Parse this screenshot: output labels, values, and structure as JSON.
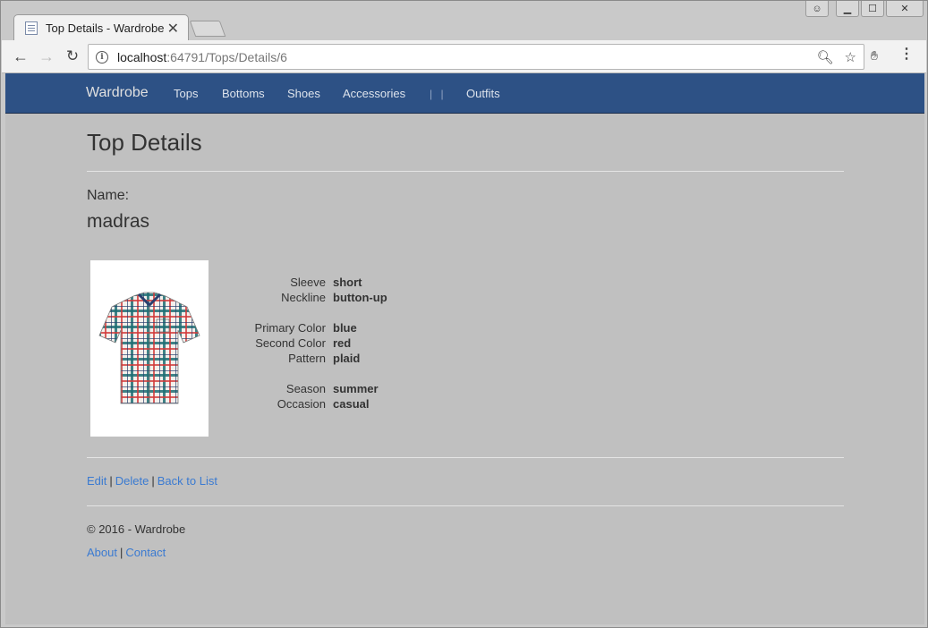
{
  "browser": {
    "tab_title": "Top Details - Wardrobe",
    "url_host": "localhost",
    "url_path": ":64791/Tops/Details/6"
  },
  "navbar": {
    "brand": "Wardrobe",
    "links": [
      "Tops",
      "Bottoms",
      "Shoes",
      "Accessories",
      "Outfits"
    ],
    "separator": "| |"
  },
  "page": {
    "title": "Top Details",
    "name_label": "Name:",
    "name_value": "madras",
    "image_alt": "plaid short-sleeve shirt",
    "attributes": [
      {
        "label": "Sleeve",
        "value": "short"
      },
      {
        "label": "Neckline",
        "value": "button-up"
      },
      {
        "label": "Primary Color",
        "value": "blue"
      },
      {
        "label": "Second Color",
        "value": "red"
      },
      {
        "label": "Pattern",
        "value": "plaid"
      },
      {
        "label": "Season",
        "value": "summer"
      },
      {
        "label": "Occasion",
        "value": "casual"
      }
    ],
    "actions": {
      "edit": "Edit",
      "delete": "Delete",
      "back": "Back to List"
    }
  },
  "footer": {
    "copyright": "© 2016 - Wardrobe",
    "about": "About",
    "contact": "Contact"
  },
  "colors": {
    "navbar": "#2d5185",
    "link": "#3a7ad1",
    "page_bg": "#c0c0c0"
  }
}
